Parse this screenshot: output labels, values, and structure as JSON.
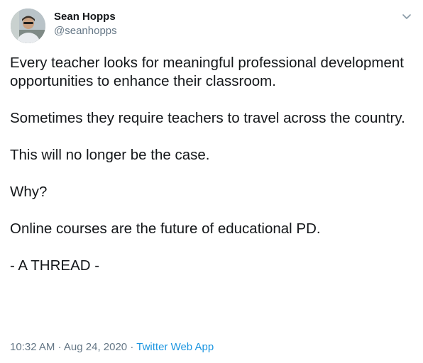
{
  "author": {
    "name": "Sean Hopps",
    "handle": "@seanhopps",
    "avatar_icon": "user-avatar"
  },
  "menu_icon": "chevron-down-icon",
  "tweet": {
    "paragraphs": [
      "Every teacher looks for meaningful professional development opportunities to enhance their classroom.",
      "Sometimes they require teachers to travel across the country.",
      "This will no longer be the case.",
      "Why?",
      "Online courses are the future of educational PD.",
      "- A THREAD -"
    ]
  },
  "meta": {
    "time": "10:32 AM",
    "separator": "·",
    "date": "Aug 24, 2020",
    "source": "Twitter Web App"
  },
  "colors": {
    "text": "#14171a",
    "secondary": "#657786",
    "link": "#1b95e0"
  }
}
